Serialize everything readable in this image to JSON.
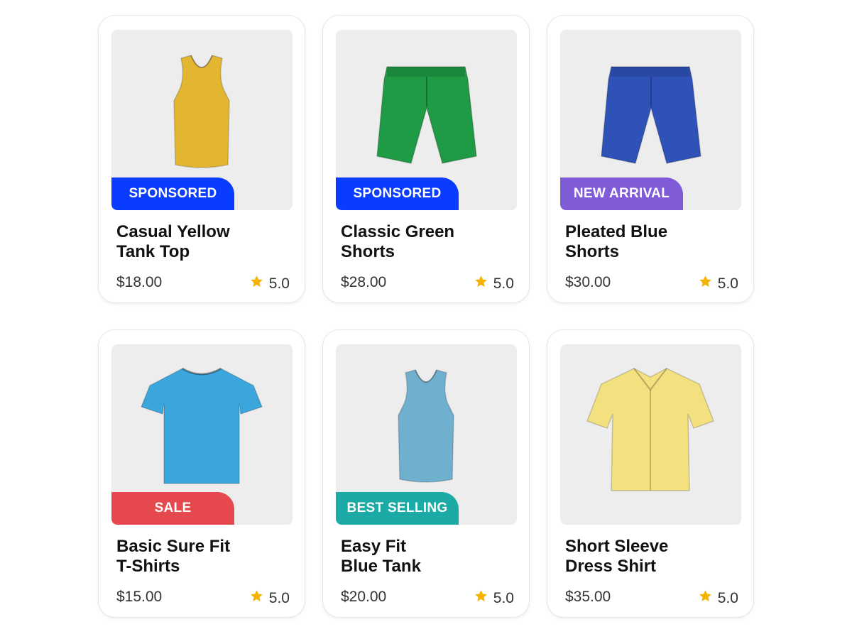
{
  "colors": {
    "sponsored": "#0a3cff",
    "new_arrival": "#7f5bd8",
    "sale": "#e5484d",
    "best_selling": "#1baaa5",
    "star": "#f5b301",
    "image_bg": "#ededed"
  },
  "products": [
    {
      "title": "Casual Yellow\nTank Top",
      "price": "$18.00",
      "rating": "5.0",
      "badge": "SPONSORED",
      "badge_color": "#0a3cff",
      "icon": "yellow-tank-top-image",
      "garment": "tank",
      "garment_color": "#e2b630"
    },
    {
      "title": "Classic Green\nShorts",
      "price": "$28.00",
      "rating": "5.0",
      "badge": "SPONSORED",
      "badge_color": "#0a3cff",
      "icon": "green-shorts-image",
      "garment": "shorts",
      "garment_color": "#1f9a45"
    },
    {
      "title": "Pleated Blue\nShorts",
      "price": "$30.00",
      "rating": "5.0",
      "badge": "NEW ARRIVAL",
      "badge_color": "#7f5bd8",
      "icon": "blue-shorts-image",
      "garment": "shorts",
      "garment_color": "#2f52b8"
    },
    {
      "title": "Basic Sure Fit\nT-Shirts",
      "price": "$15.00",
      "rating": "5.0",
      "badge": "SALE",
      "badge_color": "#e5484d",
      "icon": "blue-tshirt-image",
      "garment": "tshirt",
      "garment_color": "#3aa6dc"
    },
    {
      "title": "Easy Fit\nBlue Tank",
      "price": "$20.00",
      "rating": "5.0",
      "badge": "BEST SELLING",
      "badge_color": "#1baaa5",
      "icon": "blue-tank-image",
      "garment": "tank",
      "garment_color": "#6fb0cf"
    },
    {
      "title": "Short Sleeve\nDress Shirt",
      "price": "$35.00",
      "rating": "5.0",
      "badge": "",
      "badge_color": "",
      "icon": "yellow-dress-shirt-image",
      "garment": "shirt",
      "garment_color": "#f3e07e"
    }
  ]
}
